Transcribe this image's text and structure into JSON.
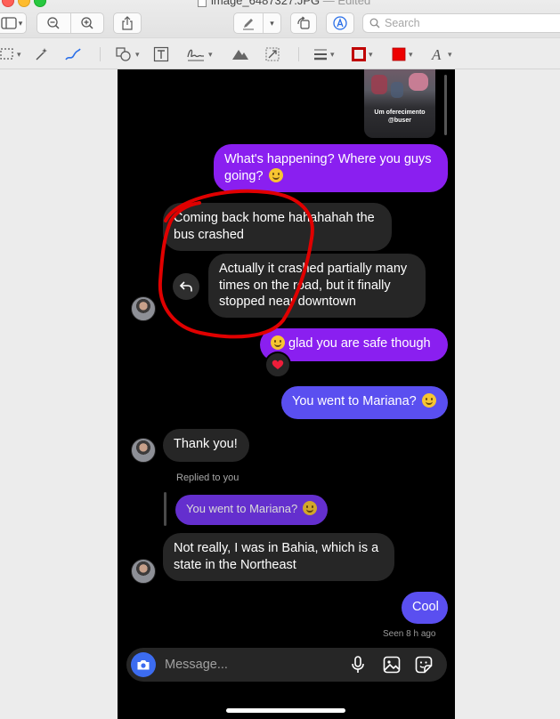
{
  "window": {
    "title": "image_6487327.JPG",
    "status": "— Edited"
  },
  "toolbar": {
    "search_placeholder": "Search"
  },
  "icons": {
    "sidebar": "sidebar-icon",
    "zoom_out": "zoom-out-icon",
    "zoom_in": "zoom-in-icon",
    "share": "share-icon",
    "markup": "markup-pen-icon",
    "rotate": "rotate-icon",
    "annotate": "annotate-icon",
    "search": "search-icon"
  },
  "colors": {
    "border_color": "#c00000",
    "fill_color": "#ee0000",
    "annotation": "#e00000"
  },
  "chat": {
    "thumbnail_caption": "Um oferecimento\n@buser",
    "messages": {
      "m1": "What's happening? Where you guys going?",
      "m2": "Coming back home hahahahah the bus crashed",
      "m3": "Actually it crashed partially many times on the road, but it finally stopped near downtown",
      "m4": "glad you are safe though",
      "m5": "You went to Mariana?",
      "m6": "Thank you!",
      "replied_label": "Replied to you",
      "quoted": "You went to Mariana?",
      "m7": "Not really, I was in Bahia, which is a state in the Northeast",
      "m8": "Cool",
      "seen": "Seen 8 h ago"
    },
    "composer_placeholder": "Message..."
  }
}
